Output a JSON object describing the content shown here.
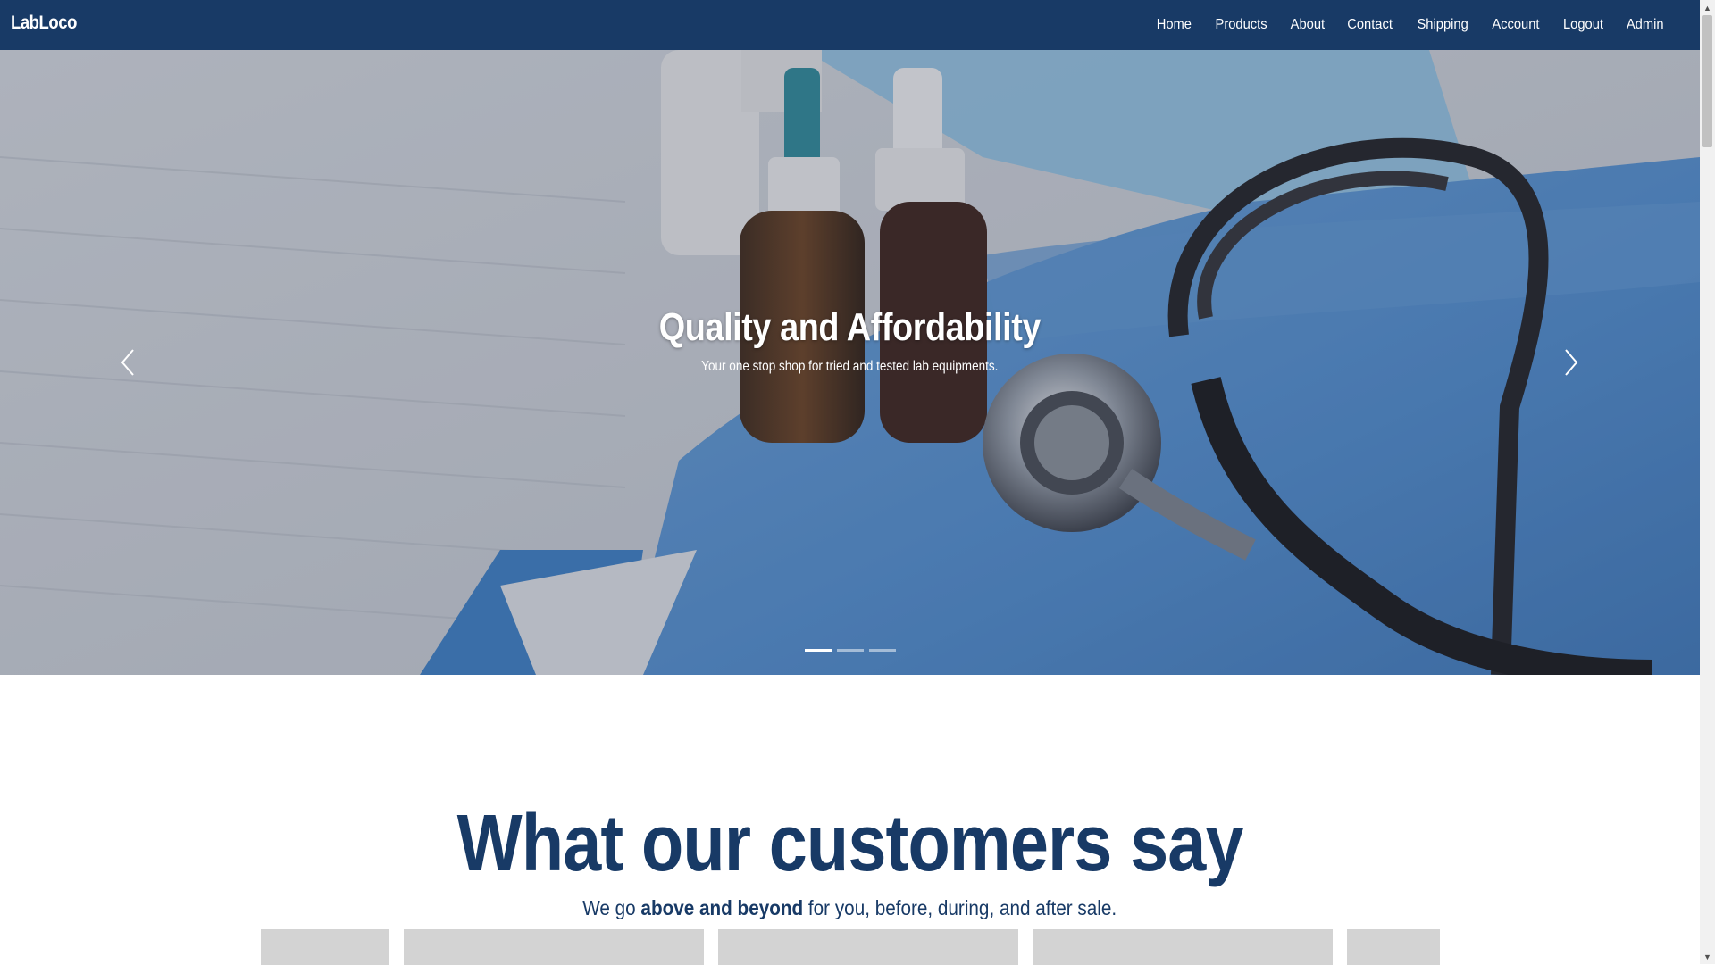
{
  "brand": {
    "name": "LabLoco"
  },
  "nav": {
    "items": [
      {
        "label": "Home"
      },
      {
        "label": "Products"
      },
      {
        "label": "About"
      },
      {
        "label": "Contact"
      },
      {
        "label": "Shipping"
      },
      {
        "label": "Account"
      },
      {
        "label": "Logout"
      },
      {
        "label": "Admin"
      }
    ]
  },
  "hero": {
    "title": "Quality and Affordability",
    "subtitle": "Your one stop shop for tried and tested lab equipments.",
    "slide_count": 3,
    "active_slide": 1,
    "prev_icon": "chevron-left-icon",
    "next_icon": "chevron-right-icon"
  },
  "testimonials": {
    "title": "What our customers say",
    "sub_prefix": "We go ",
    "sub_bold": "above and beyond",
    "sub_suffix": " for you, before, during, and after sale."
  },
  "colors": {
    "navbar": "#183a66",
    "accent": "#183a66",
    "card_placeholder": "#d3d3d3"
  }
}
